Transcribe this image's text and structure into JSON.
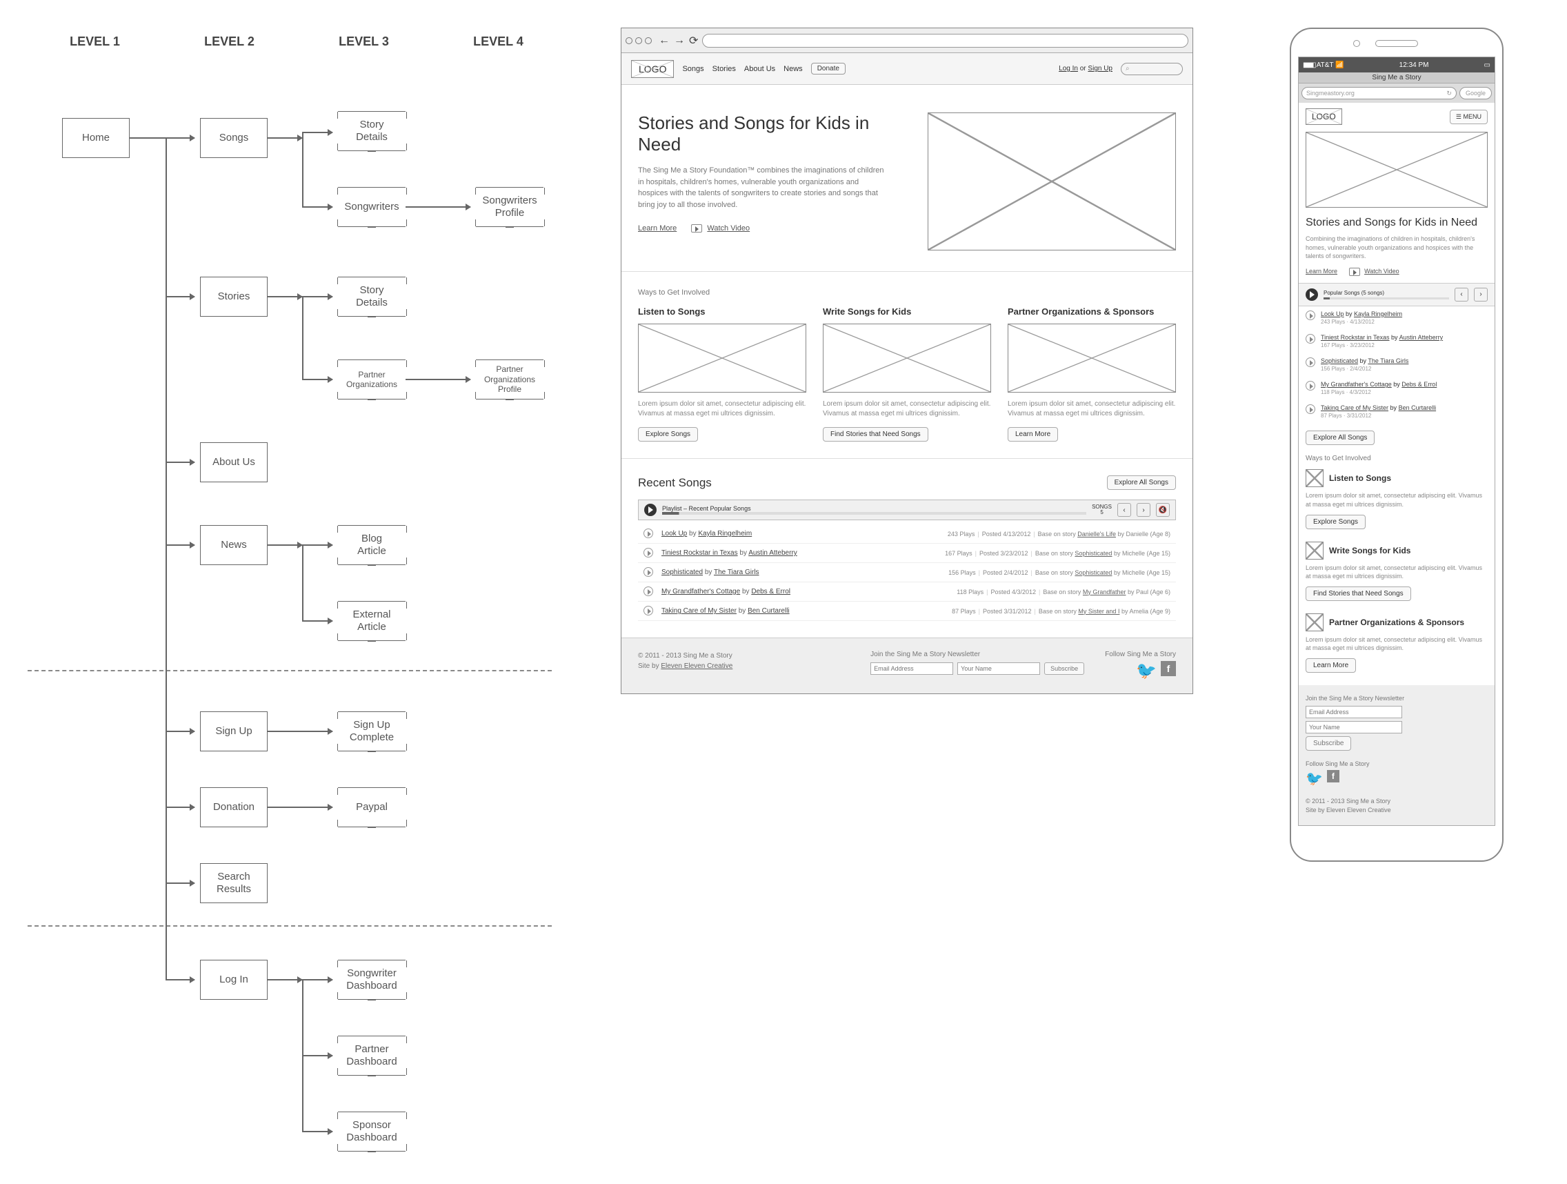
{
  "sitemap": {
    "levels": [
      "LEVEL 1",
      "LEVEL 2",
      "LEVEL 3",
      "LEVEL 4"
    ],
    "nodes": {
      "home": "Home",
      "songs": "Songs",
      "story_details": "Story\nDetails",
      "songwriters": "Songwriters",
      "songwriters_profile": "Songwriters\nProfile",
      "stories": "Stories",
      "story_details2": "Story\nDetails",
      "partner_orgs": "Partner\nOrganizations",
      "partner_orgs_profile": "Partner\nOrganizations\nProfile",
      "about_us": "About Us",
      "news": "News",
      "blog_article": "Blog\nArticle",
      "external_article": "External\nArticle",
      "sign_up": "Sign Up",
      "sign_up_complete": "Sign Up\nComplete",
      "donation": "Donation",
      "paypal": "Paypal",
      "search_results": "Search\nResults",
      "log_in": "Log In",
      "songwriter_dashboard": "Songwriter\nDashboard",
      "partner_dashboard": "Partner\nDashboard",
      "sponsor_dashboard": "Sponsor\nDashboard"
    }
  },
  "desktop": {
    "logo": "LOGO",
    "nav": [
      "Songs",
      "Stories",
      "About Us",
      "News"
    ],
    "donate": "Donate",
    "auth": {
      "login": "Log In",
      "or": "or",
      "signup": "Sign Up"
    },
    "search_icon": "⌕",
    "hero": {
      "title": "Stories and Songs for Kids in Need",
      "subtitle": "The Sing Me a Story Foundation™ combines the imaginations of children in hospitals, children's homes, vulnerable youth organizations and hospices with the talents of songwriters to create stories and songs that bring joy to all those involved.",
      "learn_more": "Learn More",
      "watch_video": "Watch Video"
    },
    "ways_title": "Ways to Get Involved",
    "ways": [
      {
        "title": "Listen to Songs",
        "desc": "Lorem ipsum dolor sit amet, consectetur adipiscing elit. Vivamus at massa eget mi ultrices dignissim.",
        "btn": "Explore Songs"
      },
      {
        "title": "Write Songs for Kids",
        "desc": "Lorem ipsum dolor sit amet, consectetur adipiscing elit. Vivamus at massa eget mi ultrices dignissim.",
        "btn": "Find Stories that Need Songs"
      },
      {
        "title": "Partner Organizations & Sponsors",
        "desc": "Lorem ipsum dolor sit amet, consectetur adipiscing elit. Vivamus at massa eget mi ultrices dignissim.",
        "btn": "Learn More"
      }
    ],
    "recent": {
      "title": "Recent Songs",
      "explore_all": "Explore All Songs",
      "playlist_label": "Playlist – Recent Popular Songs",
      "songs_count_label": "SONGS",
      "songs_count": "5",
      "prev": "‹",
      "next": "›",
      "mute": "🔇",
      "songs": [
        {
          "title": "Look Up",
          "by": "by",
          "artist": "Kayla Ringelheim",
          "plays": "243 Plays",
          "posted": "Posted 4/13/2012",
          "base": "Base on story",
          "story": "Danielle's Life",
          "author": "by Danielle (Age 8)"
        },
        {
          "title": "Tiniest Rockstar in Texas",
          "by": "by",
          "artist": "Austin Atteberry",
          "plays": "167 Plays",
          "posted": "Posted 3/23/2012",
          "base": "Base on story",
          "story": "Sophisticated",
          "author": "by Michelle (Age 15)"
        },
        {
          "title": "Sophisticated",
          "by": "by",
          "artist": "The Tiara Girls",
          "plays": "156 Plays",
          "posted": "Posted 2/4/2012",
          "base": "Base on story",
          "story": "Sophisticated",
          "author": "by Michelle (Age 15)"
        },
        {
          "title": "My Grandfather's Cottage",
          "by": "by",
          "artist": "Debs & Errol",
          "plays": "118 Plays",
          "posted": "Posted 4/3/2012",
          "base": "Base on story",
          "story": "My Grandfather",
          "author": "by Paul (Age 6)"
        },
        {
          "title": "Taking Care of My Sister",
          "by": "by",
          "artist": "Ben Curtarelli",
          "plays": "87 Plays",
          "posted": "Posted 3/31/2012",
          "base": "Base on story",
          "story": "My Sister and I",
          "author": "by Amelia (Age 9)"
        }
      ]
    },
    "footer": {
      "copyright": "© 2011 - 2013 Sing Me a Story",
      "site_by": "Site by",
      "site_by_link": "Eleven Eleven Creative",
      "newsletter_title": "Join the Sing Me a Story Newsletter",
      "email_ph": "Email Address",
      "name_ph": "Your Name",
      "subscribe": "Subscribe",
      "follow": "Follow Sing Me a Story"
    }
  },
  "mobile": {
    "status": {
      "carrier": "AT&T",
      "time": "12:34 PM",
      "battery": "▭"
    },
    "title_bar": "Sing Me a Story",
    "url": "Singmeastory.org",
    "refresh": "↻",
    "google": "Google",
    "logo": "LOGO",
    "menu": "☰ MENU",
    "hero_title": "Stories and Songs for Kids in Need",
    "hero_desc": "Combining the imaginations of children in hospitals, children's homes, vulnerable youth organizations and hospices with the talents of songwriters.",
    "learn_more": "Learn More",
    "watch_video": "Watch Video",
    "popular_label": "Popular Songs (5 songs)",
    "prev": "‹",
    "next": "›",
    "songs": [
      {
        "title": "Look Up",
        "by": "by",
        "artist": "Kayla Ringelheim",
        "meta": "243 Plays · 4/13/2012"
      },
      {
        "title": "Tiniest Rockstar in Texas",
        "by": "by",
        "artist": "Austin Atteberry",
        "meta": "167 Plays · 3/23/2012"
      },
      {
        "title": "Sophisticated",
        "by": "by",
        "artist": "The Tiara Girls",
        "meta": "156 Plays · 2/4/2012"
      },
      {
        "title": "My Grandfather's Cottage",
        "by": "by",
        "artist": "Debs & Errol",
        "meta": "118 Plays · 4/3/2012"
      },
      {
        "title": "Taking Care of My Sister",
        "by": "by",
        "artist": "Ben Curtarelli",
        "meta": "87 Plays · 3/31/2012"
      }
    ],
    "explore_all": "Explore All Songs",
    "ways_title": "Ways to Get Involved",
    "ways": [
      {
        "title": "Listen to Songs",
        "desc": "Lorem ipsum dolor sit amet, consectetur adipiscing elit. Vivamus at massa eget mi ultrices dignissim.",
        "btn": "Explore Songs"
      },
      {
        "title": "Write Songs for Kids",
        "desc": "Lorem ipsum dolor sit amet, consectetur adipiscing elit. Vivamus at massa eget mi ultrices dignissim.",
        "btn": "Find Stories that Need Songs"
      },
      {
        "title": "Partner Organizations & Sponsors",
        "desc": "Lorem ipsum dolor sit amet, consectetur adipiscing elit. Vivamus at massa eget mi ultrices dignissim.",
        "btn": "Learn More"
      }
    ],
    "footer": {
      "newsletter_title": "Join the Sing Me a Story Newsletter",
      "email_ph": "Email Address",
      "name_ph": "Your Name",
      "subscribe": "Subscribe",
      "follow": "Follow Sing Me a Story",
      "copyright": "© 2011 - 2013 Sing Me a Story",
      "site_by": "Site by",
      "site_by_link": "Eleven Eleven Creative"
    }
  }
}
